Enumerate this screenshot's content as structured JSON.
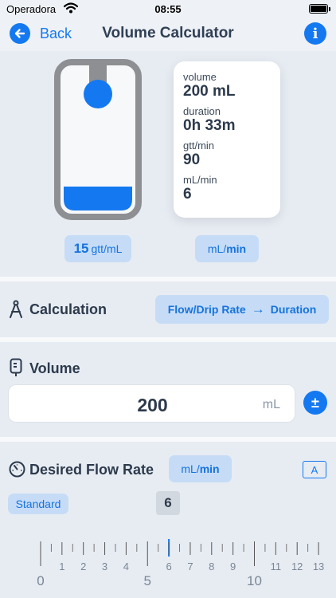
{
  "status_bar": {
    "carrier": "Operadora",
    "time": "08:55"
  },
  "nav": {
    "back_label": "Back",
    "title": "Volume Calculator",
    "info_label": "i"
  },
  "results": {
    "items": [
      {
        "label": "volume",
        "value": "200 mL"
      },
      {
        "label": "duration",
        "value": "0h 33m"
      },
      {
        "label": "gtt/min",
        "value": "90"
      },
      {
        "label": "mL/min",
        "value": "6"
      }
    ]
  },
  "drop_factor": {
    "value": "15",
    "unit": "gtt/mL"
  },
  "rate_unit": {
    "prefix": "mL/",
    "bold": "min"
  },
  "calculation": {
    "title": "Calculation",
    "mode_from": "Flow/Drip Rate",
    "mode_arrow": "→",
    "mode_to": "Duration"
  },
  "volume": {
    "title": "Volume",
    "value": "200",
    "unit": "mL",
    "adjust_label": "±"
  },
  "flow_rate": {
    "title": "Desired Flow Rate",
    "unit_prefix": "mL/",
    "unit_bold": "min",
    "keyboard_label": "A",
    "preset_label": "Standard",
    "current_value": "6"
  },
  "ruler": {
    "min": 0,
    "max": 13,
    "current": 6,
    "labels": [
      "0",
      "1",
      "2",
      "3",
      "4",
      "5",
      "6",
      "7",
      "8",
      "9",
      "10",
      "11",
      "12",
      "13"
    ],
    "major_labels": [
      "0",
      "5",
      "10"
    ]
  },
  "colors": {
    "accent": "#1479f0",
    "pill_bg": "#c6dcf6",
    "fluid": "#1479f0",
    "chamber": "#8e8f93"
  }
}
